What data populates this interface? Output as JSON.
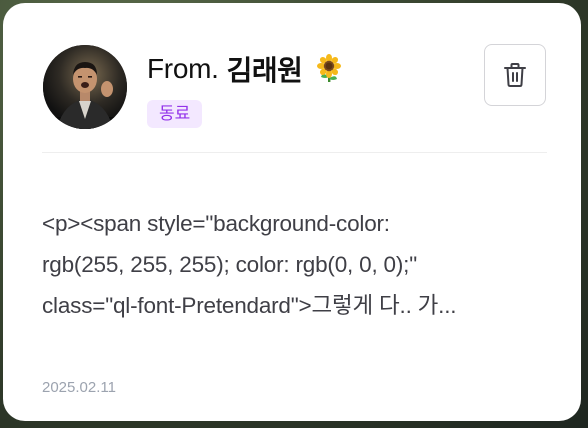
{
  "card": {
    "from_prefix": "From.",
    "sender_name": "김래원",
    "sender_emoji": "sunflower-icon",
    "relation_badge": "동료",
    "delete_icon": "trash-icon",
    "message_preview": "<p><span style=\"background-color:\nrgb(255, 255, 255); color: rgb(0, 0, 0);\"\nclass=\"ql-font-Pretendard\">그렇게 다.. 가...",
    "date": "2025.02.11"
  },
  "colors": {
    "badge_bg": "#f3e8ff",
    "badge_text": "#9333ea",
    "card_bg": "#ffffff",
    "date_text": "#9ca3af"
  }
}
